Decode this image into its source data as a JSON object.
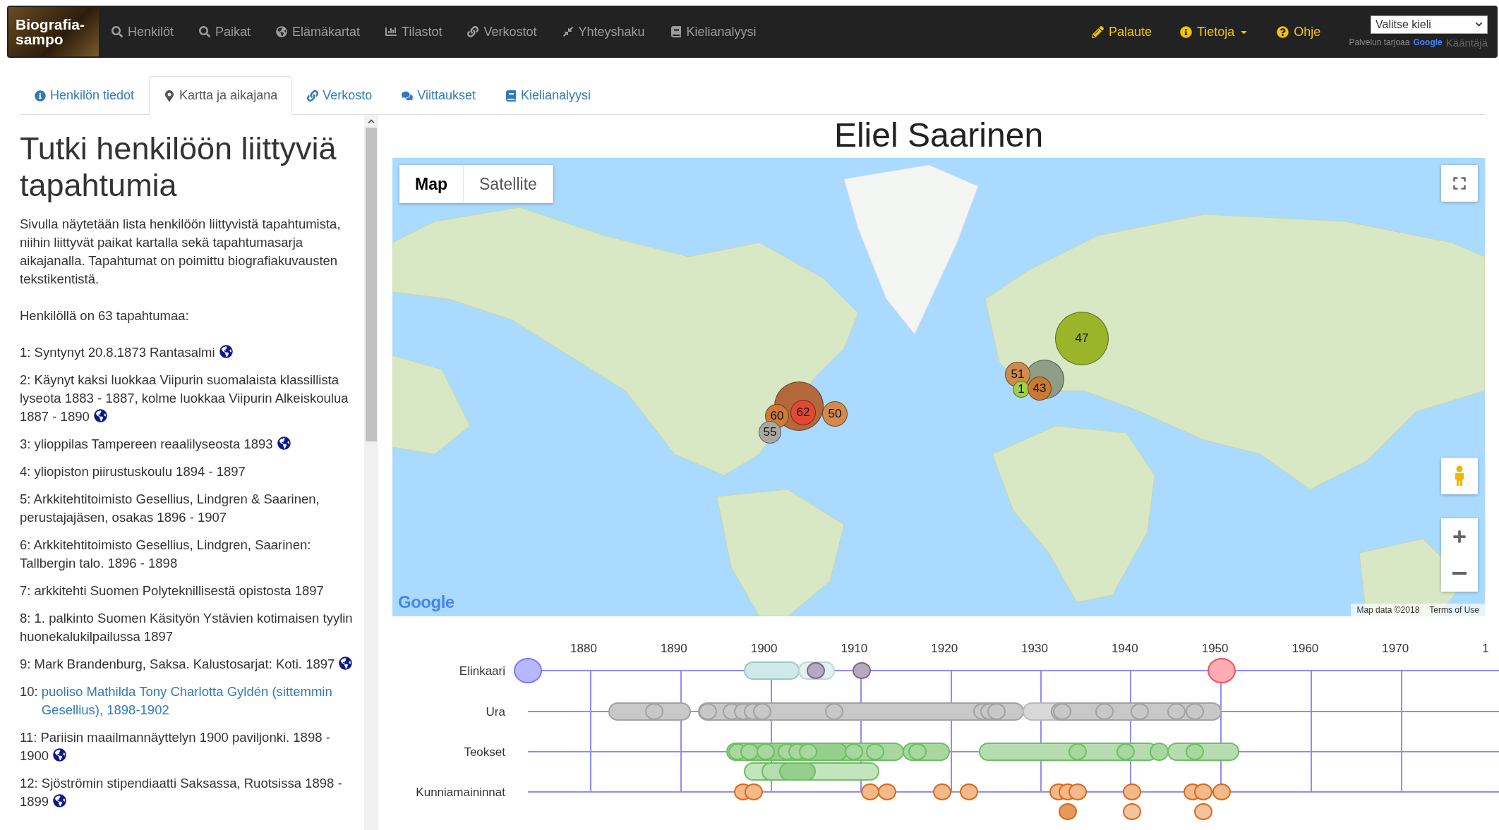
{
  "navbar": {
    "logo": "Biografia-sampo",
    "items": [
      {
        "label": "Henkilöt"
      },
      {
        "label": "Paikat"
      },
      {
        "label": "Elämäkartat"
      },
      {
        "label": "Tilastot"
      },
      {
        "label": "Verkostot"
      },
      {
        "label": "Yhteyshaku"
      },
      {
        "label": "Kielianalyysi"
      }
    ],
    "right_items": [
      {
        "label": "Palaute",
        "dropdown": false
      },
      {
        "label": "Tietoja",
        "dropdown": true
      },
      {
        "label": "Ohje",
        "dropdown": false
      }
    ],
    "language_select": {
      "value": "Valitse kieli"
    },
    "translate_note": {
      "prefix": "Palvelun tarjoaa",
      "logo": "Google",
      "suffix": "Kääntäjä"
    }
  },
  "tabs": [
    {
      "label": "Henkilön tiedot",
      "selected": false
    },
    {
      "label": "Kartta ja aikajana",
      "selected": true
    },
    {
      "label": "Verkosto",
      "selected": false
    },
    {
      "label": "Viittaukset",
      "selected": false
    },
    {
      "label": "Kielianalyysi",
      "selected": false
    }
  ],
  "sidebar": {
    "title": "Tutki henkilöön liittyviä tapahtumia",
    "intro": "Sivulla näytetään lista henkilöön liittyvistä tapahtumista, niihin liittyvät paikat kartalla sekä tapahtumasarja aikajanalla. Tapahtumat on poimittu biografiakuvausten tekstikentistä.",
    "count": "Henkilöllä on 63 tapahtumaa:",
    "events": [
      {
        "number": "1:",
        "text": "Syntynyt 20.8.1873 Rantasalmi",
        "linked": false,
        "has_place": true
      },
      {
        "number": "2:",
        "text": "Käynyt kaksi luokkaa Viipurin suomalaista klassillista lyseota 1883 - 1887, kolme luokkaa Viipurin Alkeiskoulua 1887 - 1890",
        "linked": false,
        "has_place": true
      },
      {
        "number": "3:",
        "text": "ylioppilas Tampereen reaalilyseosta 1893",
        "linked": false,
        "has_place": true
      },
      {
        "number": "4:",
        "text": "yliopiston piirustuskoulu 1894 - 1897",
        "linked": false,
        "has_place": false
      },
      {
        "number": "5:",
        "text": "Arkkitehtitoimisto Gesellius, Lindgren & Saarinen, perustajajäsen, osakas 1896 - 1907",
        "linked": false,
        "has_place": false
      },
      {
        "number": "6:",
        "text": "Arkkitehtitoimisto Gesellius, Lindgren, Saarinen: Tallbergin talo. 1896 - 1898",
        "linked": false,
        "has_place": false
      },
      {
        "number": "7:",
        "text": "arkkitehti Suomen Polyteknillisestä opistosta 1897",
        "linked": false,
        "has_place": false
      },
      {
        "number": "8:",
        "text": "1. palkinto Suomen Käsityön Ystävien kotimaisen tyylin huonekalukilpailussa 1897",
        "linked": false,
        "has_place": false
      },
      {
        "number": "9:",
        "text": "Mark Brandenburg, Saksa. Kalustosarjat: Koti. 1897",
        "linked": false,
        "has_place": true
      },
      {
        "number": "10:",
        "text": "puoliso Mathilda Tony Charlotta Gyldén (sittemmin Gesellius), 1898-1902",
        "linked": true,
        "has_place": false
      },
      {
        "number": "11:",
        "text": "Pariisin maailmannäyttelyn 1900 paviljonki. 1898 - 1900",
        "linked": false,
        "has_place": true
      },
      {
        "number": "12:",
        "text": "Sjöströmin stipendiaatti Saksassa, Ruotsissa 1898 - 1899",
        "linked": false,
        "has_place": true
      }
    ]
  },
  "person": {
    "name": "Eliel Saarinen"
  },
  "map": {
    "type_buttons": [
      {
        "label": "Map",
        "selected": true
      },
      {
        "label": "Satellite",
        "selected": false
      }
    ],
    "markers": [
      {
        "label": "47",
        "color": "#9ab52a"
      },
      {
        "color": "#8e9e86"
      },
      {
        "label": "51",
        "color": "#d08a4a"
      },
      {
        "label": "1",
        "color": "#9fd04a"
      },
      {
        "label": "43",
        "color": "#c97a32"
      },
      {
        "color": "#b3693a"
      },
      {
        "label": "60",
        "color": "#cf7a36"
      },
      {
        "label": "62",
        "color": "#e04a34"
      },
      {
        "label": "50",
        "color": "#d28a4e"
      },
      {
        "label": "55",
        "color": "#a9a9a4"
      }
    ],
    "logo": "Google",
    "attribution": "Map data ©2018",
    "terms": "Terms of Use"
  },
  "timeline": {
    "years": [
      "1880",
      "1890",
      "1900",
      "1910",
      "1920",
      "1930",
      "1940",
      "1950",
      "1960",
      "1970",
      "1"
    ],
    "lanes": [
      {
        "label": "Elinkaari"
      },
      {
        "label": "Ura"
      },
      {
        "label": "Teokset"
      },
      {
        "label": "Kunniamaininnat"
      }
    ]
  }
}
